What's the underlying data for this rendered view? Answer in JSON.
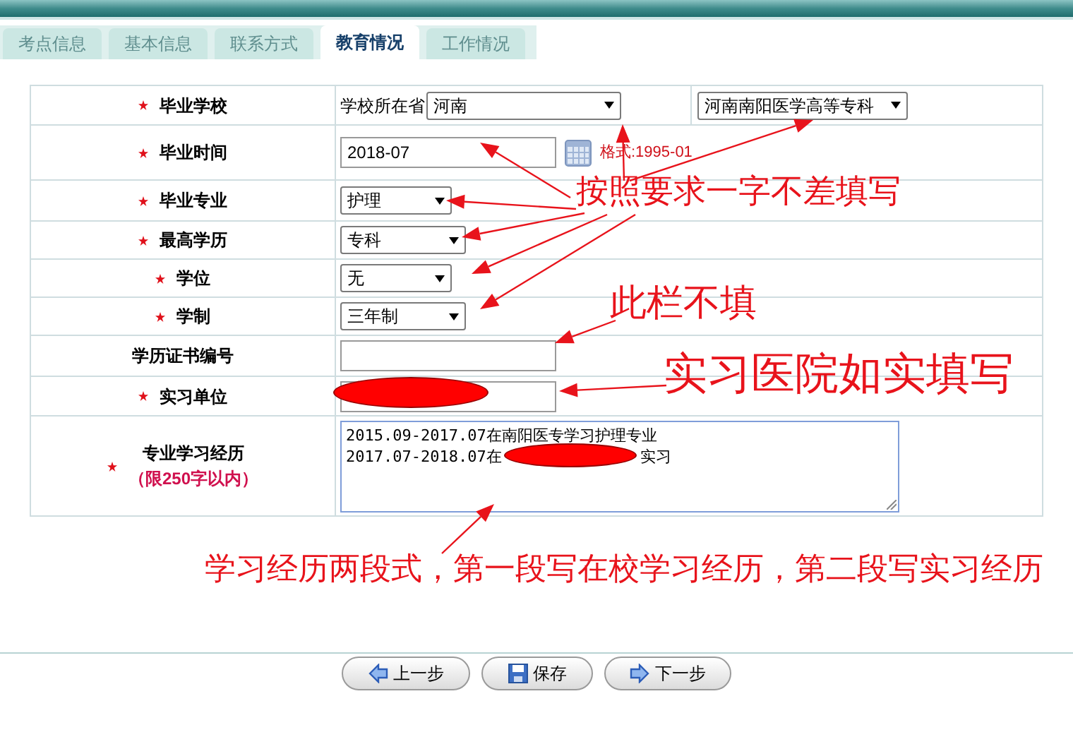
{
  "tabs": [
    {
      "label": "考点信息",
      "selected": false
    },
    {
      "label": "基本信息",
      "selected": false
    },
    {
      "label": "联系方式",
      "selected": false
    },
    {
      "label": "教育情况",
      "selected": true
    },
    {
      "label": "工作情况",
      "selected": false
    }
  ],
  "form": [
    {
      "label": "毕业学校",
      "required": true,
      "kind": "school",
      "prefix": "学校所在省",
      "province": "河南",
      "school": "河南南阳医学高等专科"
    },
    {
      "label": "毕业时间",
      "required": true,
      "kind": "date",
      "value": "2018-07",
      "hint": "格式:1995-01"
    },
    {
      "label": "毕业专业",
      "required": true,
      "kind": "select",
      "value": "护理"
    },
    {
      "label": "最高学历",
      "required": true,
      "kind": "select",
      "value": "专科"
    },
    {
      "label": "学位",
      "required": true,
      "kind": "select",
      "value": "无"
    },
    {
      "label": "学制",
      "required": true,
      "kind": "select",
      "value": "三年制"
    },
    {
      "label": "学历证书编号",
      "required": false,
      "kind": "text",
      "redacted": false
    },
    {
      "label": "实习单位",
      "required": true,
      "kind": "text",
      "redacted": true
    },
    {
      "label": "专业学习经历",
      "required": true,
      "kind": "textarea",
      "note": "（限250字以内）",
      "line_1": "2015.09-2017.07在南阳医专学习护理专业",
      "line_2_before": "2017.07-2018.07在",
      "line_2_after": "实习"
    }
  ],
  "annotations": [
    {
      "text": "按照要求一字不差填写"
    },
    {
      "text": "此栏不填"
    },
    {
      "text": "实习医院如实填写"
    },
    {
      "text": "学习经历两段式，第一段写在校学习经历，第二段写实习经历"
    }
  ],
  "buttons": [
    {
      "label": "上一步",
      "kind": "prev"
    },
    {
      "label": "保存",
      "kind": "save"
    },
    {
      "label": "下一步",
      "kind": "next"
    }
  ]
}
